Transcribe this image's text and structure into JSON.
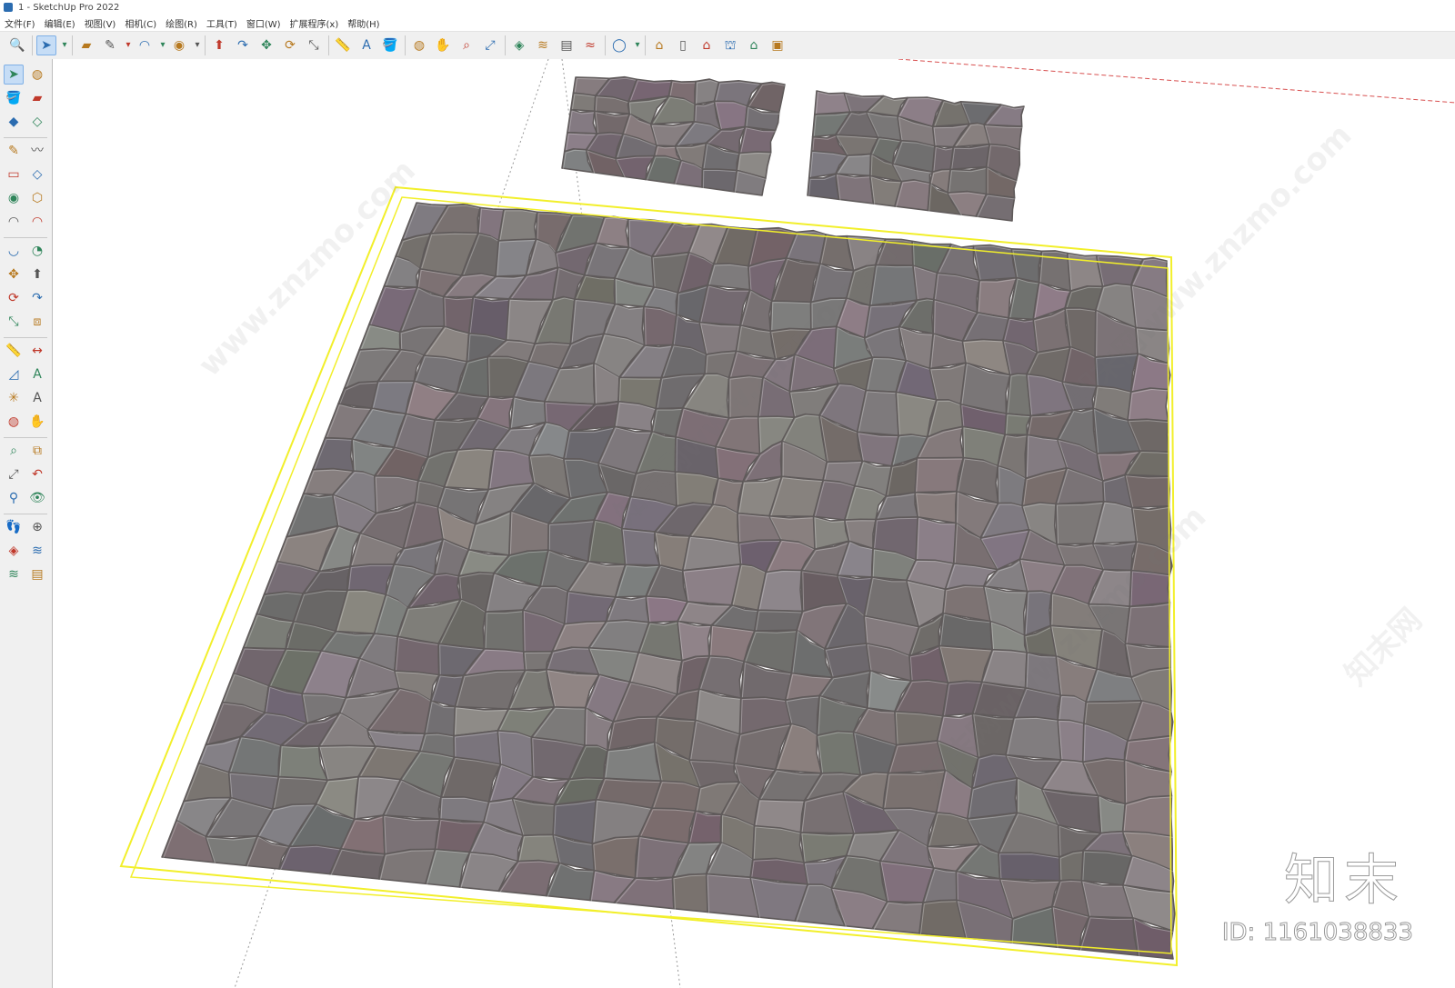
{
  "window": {
    "title": "1 - SketchUp Pro 2022"
  },
  "menu": [
    "文件(F)",
    "编辑(E)",
    "视图(V)",
    "相机(C)",
    "绘图(R)",
    "工具(T)",
    "窗口(W)",
    "扩展程序(x)",
    "帮助(H)"
  ],
  "toolbar_icons": [
    "search-icon",
    "select-arrow-icon",
    "dropdown-arrow-icon",
    "eraser-icon",
    "pencil-icon",
    "dropdown-arrow-icon",
    "arc-icon",
    "dropdown-arrow-icon",
    "circle-icon",
    "dropdown-arrow-icon",
    "push-pull-icon",
    "follow-me-icon",
    "move-icon",
    "rotate-icon",
    "scale-icon",
    "tape-measure-icon",
    "text-icon",
    "paint-bucket-icon",
    "orbit-icon",
    "pan-icon",
    "zoom-icon",
    "zoom-extents-icon",
    "sandbox-icon",
    "smoove-icon",
    "stamp-icon",
    "drape-icon",
    "account-icon",
    "dropdown-arrow-icon",
    "3d-warehouse-icon",
    "extension-warehouse-icon",
    "home-icon",
    "components-icon",
    "house-outline-icon",
    "styles-icon"
  ],
  "sidebar_icons": [
    "select-arrow-icon",
    "orbit-icon",
    "paint-bucket-icon",
    "eraser-icon",
    "component-icon",
    "tag-icon",
    "pencil-icon",
    "freehand-icon",
    "rectangle-icon",
    "rotated-rectangle-icon",
    "circle-icon",
    "polygon-icon",
    "arc-icon",
    "two-point-arc-icon",
    "three-point-arc-icon",
    "pie-icon",
    "move-icon",
    "push-pull-icon",
    "rotate-icon",
    "follow-me-icon",
    "scale-icon",
    "offset-icon",
    "tape-measure-icon",
    "dimension-icon",
    "protractor-icon",
    "text-icon",
    "axes-icon",
    "3d-text-icon",
    "orbit-icon",
    "pan-icon",
    "zoom-icon",
    "zoom-window-icon",
    "zoom-extents-icon",
    "previous-view-icon",
    "position-camera-icon",
    "look-around-icon",
    "walk-icon",
    "section-plane-icon",
    "sandbox-from-contours-icon",
    "sandbox-from-scratch-icon",
    "smoove-icon",
    "stamp-icon"
  ],
  "watermarks": [
    "www.znzmo.com",
    "知末网www.znzmo.com",
    "知末网www.znzmo.com",
    "知末网www.znzmo.com",
    "知末网"
  ],
  "brand": {
    "name": "知末",
    "id_text": "ID: 1161038833"
  },
  "colors": {
    "selection_box": "#f2ef2a",
    "stone_base": "#7c7777",
    "stone_edge": "#5f5a5a",
    "axis_red": "#d85050"
  }
}
